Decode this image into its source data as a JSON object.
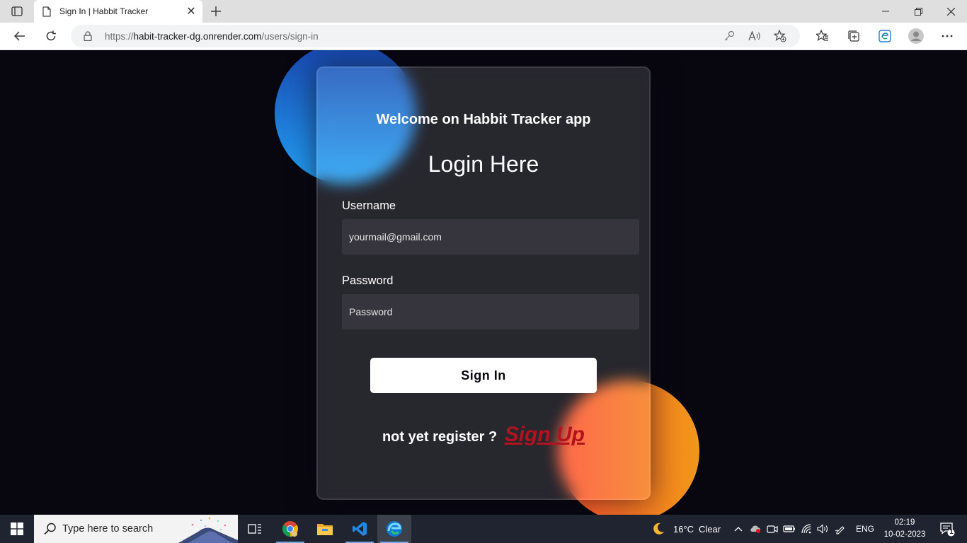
{
  "browser": {
    "tab_title": "Sign In | Habbit Tracker",
    "url_prefix": "https://",
    "url_host": "habit-tracker-dg.onrender.com",
    "url_path": "/users/sign-in"
  },
  "page": {
    "welcome": "Welcome on Habbit Tracker app",
    "title": "Login Here",
    "username_label": "Username",
    "username_placeholder": "yourmail@gmail.com",
    "password_label": "Password",
    "password_placeholder": "Password",
    "signin_label": "Sign In",
    "register_prompt": "not yet register ?",
    "signup_label": "Sign Up"
  },
  "taskbar": {
    "search_placeholder": "Type here to search",
    "weather_temp": "16°C",
    "weather_text": "Clear",
    "language": "ENG",
    "time": "02:19",
    "date": "10-02-2023",
    "notification_count": "1"
  },
  "colors": {
    "page_bg": "#080710",
    "signup_red": "#b4121f",
    "blue_gradient": [
      "#1845ad",
      "#23a2f6"
    ],
    "orange_gradient": [
      "#ff512f",
      "#f09819"
    ]
  }
}
